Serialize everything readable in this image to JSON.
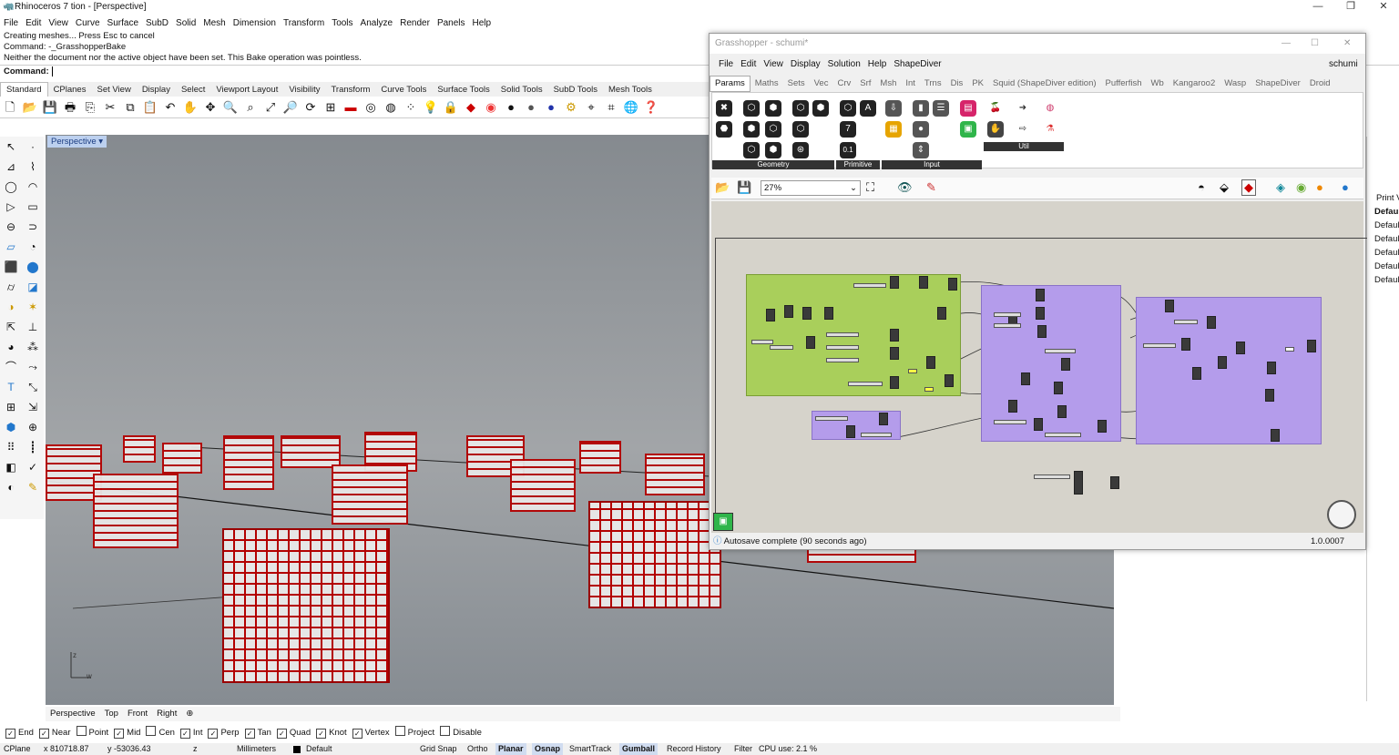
{
  "window": {
    "title": "Rhinoceros 7 tion - [Perspective]",
    "min": "—",
    "max": "❐",
    "close": "✕"
  },
  "menu": [
    "File",
    "Edit",
    "View",
    "Curve",
    "Surface",
    "SubD",
    "Solid",
    "Mesh",
    "Dimension",
    "Transform",
    "Tools",
    "Analyze",
    "Render",
    "Panels",
    "Help"
  ],
  "command_history": [
    "Creating meshes... Press Esc to cancel",
    "Command: -_GrasshopperBake",
    "Neither the document nor the active object have been set. This Bake operation was pointless."
  ],
  "command_prompt": "Command:",
  "toolbar_tabs": [
    "Standard",
    "CPlanes",
    "Set View",
    "Display",
    "Select",
    "Viewport Layout",
    "Visibility",
    "Transform",
    "Curve Tools",
    "Surface Tools",
    "Solid Tools",
    "SubD Tools",
    "Mesh Tools"
  ],
  "viewport": {
    "label": "Perspective",
    "dropdown": "▾"
  },
  "viewport_tabs": [
    "Perspective",
    "Top",
    "Front",
    "Right",
    "⊕"
  ],
  "osnaps": [
    {
      "label": "End",
      "on": true
    },
    {
      "label": "Near",
      "on": true
    },
    {
      "label": "Point",
      "on": false
    },
    {
      "label": "Mid",
      "on": true
    },
    {
      "label": "Cen",
      "on": false
    },
    {
      "label": "Int",
      "on": true
    },
    {
      "label": "Perp",
      "on": true
    },
    {
      "label": "Tan",
      "on": true
    },
    {
      "label": "Quad",
      "on": true
    },
    {
      "label": "Knot",
      "on": true
    },
    {
      "label": "Vertex",
      "on": true
    },
    {
      "label": "Project",
      "on": false
    },
    {
      "label": "Disable",
      "on": false
    }
  ],
  "status": {
    "cplane": "CPlane",
    "x": "x 810718.87",
    "y": "y -53036.43",
    "z": "z",
    "units": "Millimeters",
    "layer": "Default",
    "grid_snap": "Grid Snap",
    "ortho": "Ortho",
    "planar": "Planar",
    "osnap": "Osnap",
    "smarttrack": "SmartTrack",
    "gumball": "Gumball",
    "record_history": "Record History",
    "filter": "Filter",
    "cpu": "CPU use: 2.1 %"
  },
  "right_panel": [
    "Print V",
    "Defau",
    "Defaul",
    "Defaul",
    "Defaul",
    "Defaul",
    "Defaul"
  ],
  "grasshopper": {
    "title": "Grasshopper - schumi*",
    "menu": [
      "File",
      "Edit",
      "View",
      "Display",
      "Solution",
      "Help",
      "ShapeDiver"
    ],
    "user": "schumi",
    "tabs": [
      "Params",
      "Maths",
      "Sets",
      "Vec",
      "Crv",
      "Srf",
      "Msh",
      "Int",
      "Trns",
      "Dis",
      "PK",
      "Squid (ShapeDiver edition)",
      "Pufferfish",
      "Wb",
      "Kangaroo2",
      "Wasp",
      "ShapeDiver",
      "Droid"
    ],
    "groups": [
      "Geometry",
      "Primitive",
      "Input",
      "Util"
    ],
    "zoom": "27%",
    "status": "Autosave complete (90 seconds ago)",
    "version": "1.0.0007"
  },
  "colors": {
    "accent": "#b30000",
    "gh_green": "#a9cf5b",
    "gh_purple": "#b49ceb"
  }
}
